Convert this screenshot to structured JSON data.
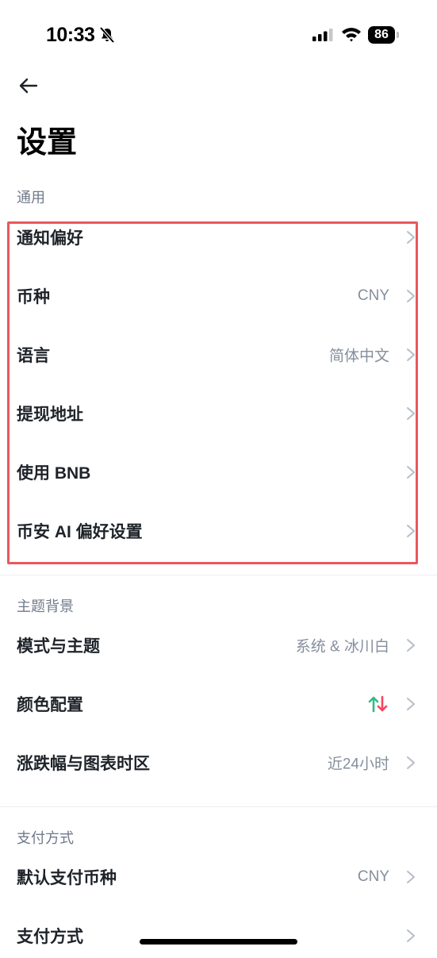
{
  "status_bar": {
    "time": "10:33",
    "battery": "86"
  },
  "header": {
    "title": "设置"
  },
  "sections": {
    "general": {
      "label": "通用",
      "rows": [
        {
          "label": "通知偏好",
          "value": ""
        },
        {
          "label": "币种",
          "value": "CNY"
        },
        {
          "label": "语言",
          "value": "简体中文"
        },
        {
          "label": "提现地址",
          "value": ""
        },
        {
          "label": "使用 BNB",
          "value": ""
        },
        {
          "label": "币安 AI 偏好设置",
          "value": ""
        }
      ]
    },
    "theme": {
      "label": "主题背景",
      "rows": [
        {
          "label": "模式与主题",
          "value": "系统 & 冰川白"
        },
        {
          "label": "颜色配置",
          "value": ""
        },
        {
          "label": "涨跌幅与图表时区",
          "value": "近24小时"
        }
      ]
    },
    "payment": {
      "label": "支付方式",
      "rows": [
        {
          "label": "默认支付币种",
          "value": "CNY"
        },
        {
          "label": "支付方式",
          "value": ""
        }
      ]
    }
  },
  "colors": {
    "up": "#2ebd85",
    "down": "#f6465d",
    "highlight": "#e8585d"
  },
  "icons": {
    "back": "arrow-left-icon",
    "chevron": "chevron-right-icon",
    "color_config": "up-down-arrows-icon",
    "bell": "bell-slash-icon"
  }
}
